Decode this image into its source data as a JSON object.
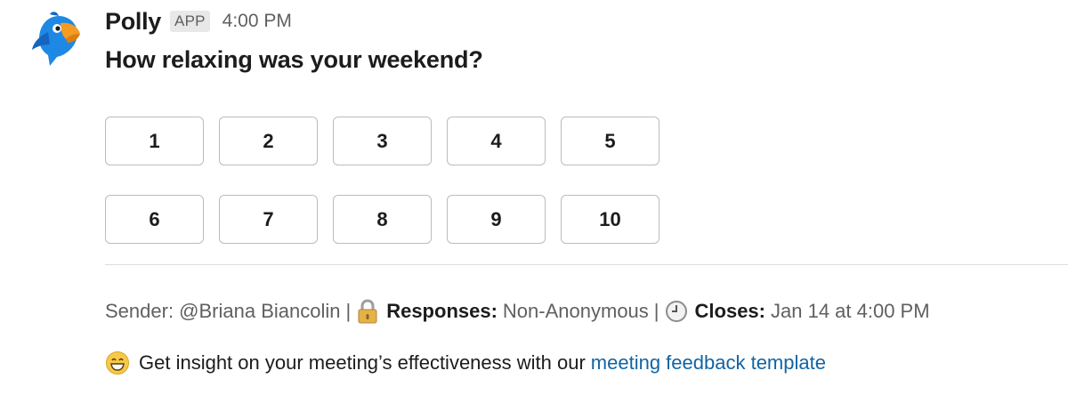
{
  "message": {
    "sender": "Polly",
    "badge": "APP",
    "time": "4:00 PM",
    "question": "How relaxing was your weekend?"
  },
  "options": {
    "row1": [
      "1",
      "2",
      "3",
      "4",
      "5"
    ],
    "row2": [
      "6",
      "7",
      "8",
      "9",
      "10"
    ]
  },
  "meta": {
    "sender_prefix": "Sender: @Briana Biancolin",
    "separator": "|",
    "responses_label": "Responses:",
    "responses_value": "Non-Anonymous",
    "closes_label": "Closes:",
    "closes_value": "Jan 14 at 4:00 PM",
    "icons": [
      "padlock-icon",
      "clock-icon"
    ]
  },
  "footer": {
    "text": "Get insight on your meeting’s effectiveness with our",
    "link": "meeting feedback template",
    "icon": "grinning-emoji-icon"
  },
  "colors": {
    "link": "#1264a3",
    "brand_blue": "#1e88e5",
    "brand_orange": "#f59b23"
  }
}
